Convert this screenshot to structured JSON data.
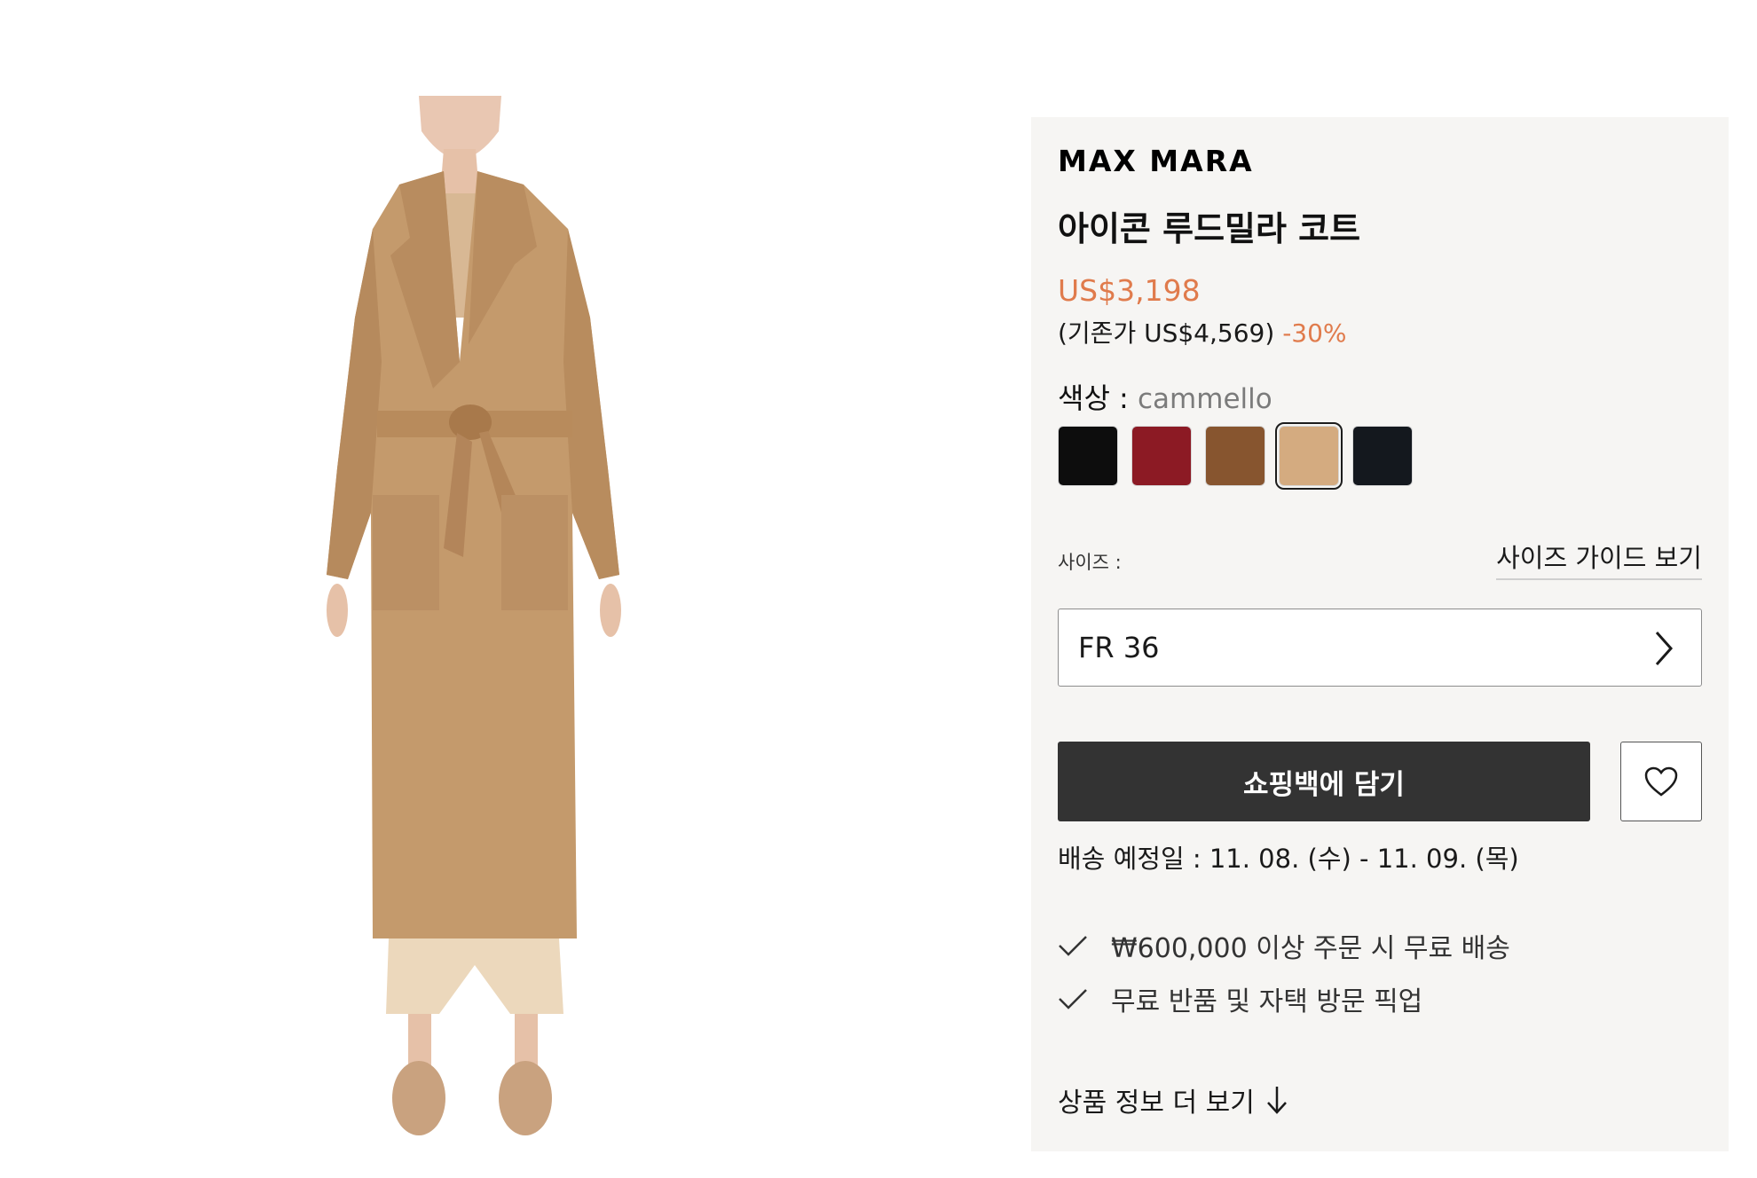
{
  "product": {
    "brand": "MAX MARA",
    "title": "아이콘 루드밀라 코트",
    "price": "US$3,198",
    "original_price": "(기존가 US$4,569)",
    "discount": "-30%"
  },
  "color": {
    "label": "색상 : ",
    "value": "cammello",
    "swatches": [
      {
        "name": "black",
        "hex": "#0d0d0d"
      },
      {
        "name": "red",
        "hex": "#8c1a24"
      },
      {
        "name": "brown",
        "hex": "#87552f"
      },
      {
        "name": "camel",
        "hex": "#d4ab80",
        "selected": true
      },
      {
        "name": "navy",
        "hex": "#14181e"
      }
    ]
  },
  "size": {
    "label": "사이즈 :",
    "guide_link": "사이즈 가이드 보기",
    "selected": "FR 36"
  },
  "actions": {
    "add_to_bag": "쇼핑백에 담기",
    "wishlist_icon": "heart-icon"
  },
  "delivery": "배송 예정일 : 11. 08. (수) - 11. 09. (목)",
  "benefits": [
    "₩600,000 이상 주문 시 무료 배송",
    "무료 반품 및 자택 방문 픽업"
  ],
  "more_info": "상품 정보 더 보기"
}
